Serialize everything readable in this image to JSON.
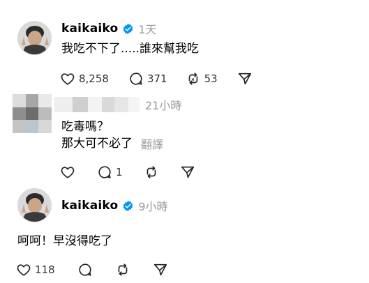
{
  "posts": [
    {
      "username": "kaikaiko",
      "timestamp": "1天",
      "text": "我吃不下了.....誰來幫我吃",
      "likes": "8,258",
      "replies": "371",
      "reposts": "53"
    },
    {
      "timestamp": "21小時",
      "text_line1": "吃毒嗎？",
      "text_line2": "那大可不必了",
      "translate": "翻譯",
      "replies": "1"
    },
    {
      "username": "kaikaiko",
      "timestamp": "9小時",
      "text": "呵呵！早沒得吃了",
      "likes": "118"
    }
  ],
  "icons": {
    "verified": "verified-badge-icon",
    "like": "heart-icon",
    "reply": "comment-bubble-icon",
    "repost": "repost-icon",
    "share": "send-icon"
  },
  "colors": {
    "verified_blue": "#0095f6",
    "muted_text": "#999999"
  }
}
